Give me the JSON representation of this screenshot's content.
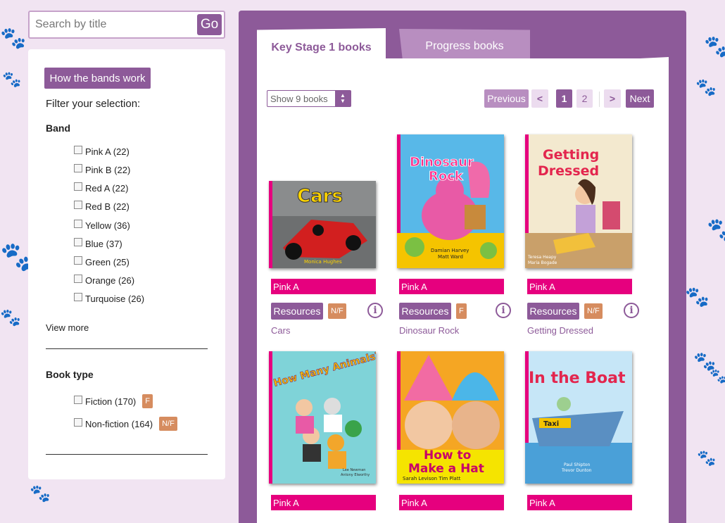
{
  "search": {
    "placeholder": "Search by title",
    "go_label": "Go"
  },
  "sidebar": {
    "bands_button": "How the bands work",
    "filter_label": "Filter your selection:",
    "band_title": "Band",
    "bands": [
      {
        "label": "Pink A (22)"
      },
      {
        "label": "Pink B (22)"
      },
      {
        "label": "Red A (22)"
      },
      {
        "label": "Red B (22)"
      },
      {
        "label": "Yellow (36)"
      },
      {
        "label": "Blue (37)"
      },
      {
        "label": "Green (25)"
      },
      {
        "label": "Orange (26)"
      },
      {
        "label": "Turquoise (26)"
      }
    ],
    "view_more": "View more",
    "book_type_title": "Book type",
    "book_types": [
      {
        "label": "Fiction (170)",
        "badge": "F"
      },
      {
        "label": "Non-fiction (164)",
        "badge": "N/F"
      }
    ]
  },
  "tabs": {
    "active": "Key Stage 1 books",
    "inactive": "Progress books"
  },
  "controls": {
    "show_select": "Show 9 books",
    "previous": "Previous",
    "prev_arrow": "<",
    "page_1": "1",
    "page_2": "2",
    "next_arrow": ">",
    "next": "Next"
  },
  "books": [
    {
      "band": "Pink A",
      "resources": "Resources",
      "type_badge": "N/F",
      "title": "Cars",
      "cover_text": "Cars",
      "cover_authors": "Monica Hughes"
    },
    {
      "band": "Pink A",
      "resources": "Resources",
      "type_badge": "F",
      "title": "Dinosaur Rock",
      "cover_text": "Dinosaur Rock",
      "cover_authors": "Damian Harvey / Matt Ward"
    },
    {
      "band": "Pink A",
      "resources": "Resources",
      "type_badge": "N/F",
      "title": "Getting Dressed",
      "cover_text": "Getting Dressed",
      "cover_authors": "Teresa Heapy / Maria Bogade"
    },
    {
      "band": "Pink A",
      "cover_text": "How Many Animals?",
      "cover_authors": "Lee Newman / Antony Elworthy"
    },
    {
      "band": "Pink A",
      "cover_text": "How to Make a Hat",
      "cover_authors": "Sarah Levison   Tim Platt"
    },
    {
      "band": "Pink A",
      "cover_text": "In the Boat",
      "cover_authors": "Paul Shipton / Trevor Dunton"
    }
  ],
  "colors": {
    "brand_purple": "#8d5a99",
    "band_pink": "#e6007e",
    "badge_orange": "#d68c5f",
    "background": "#f1e4f2"
  },
  "icons": {
    "info": "i"
  }
}
